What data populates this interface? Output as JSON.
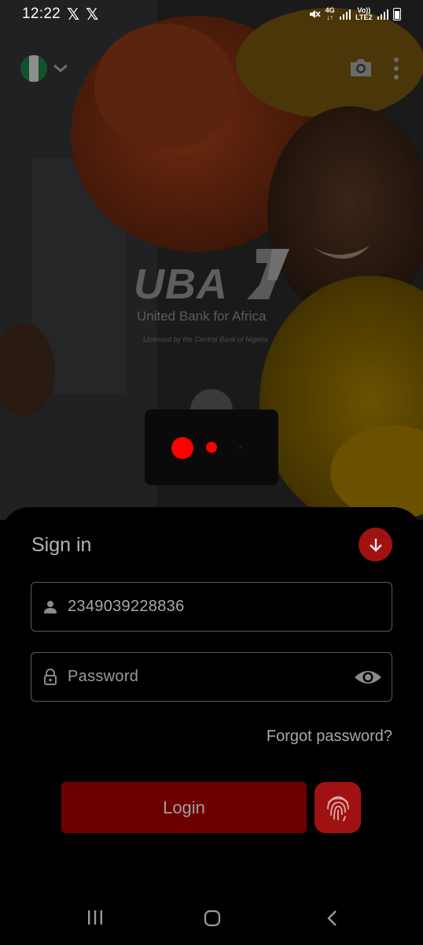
{
  "status_bar": {
    "time": "12:22",
    "notification_icons": [
      "x-logo",
      "x-logo"
    ],
    "network_top": "4G",
    "network_volte": "Vo))",
    "network_lte": "LTE2"
  },
  "header": {
    "country_flag": "nigeria-flag",
    "actions": [
      "camera-icon",
      "more-vert-icon"
    ]
  },
  "brand": {
    "wordmark": "UBA",
    "tagline": "United Bank for Africa",
    "license": "Licensed by the Central Bank of Nigeria"
  },
  "signin": {
    "title": "Sign in",
    "phone_value": "2349039228836",
    "password_placeholder": "Password",
    "forgot_label": "Forgot password?",
    "login_label": "Login"
  },
  "colors": {
    "accent": "#a01212",
    "login_bg": "#6f0000",
    "loader_dot": "#ff0000"
  }
}
